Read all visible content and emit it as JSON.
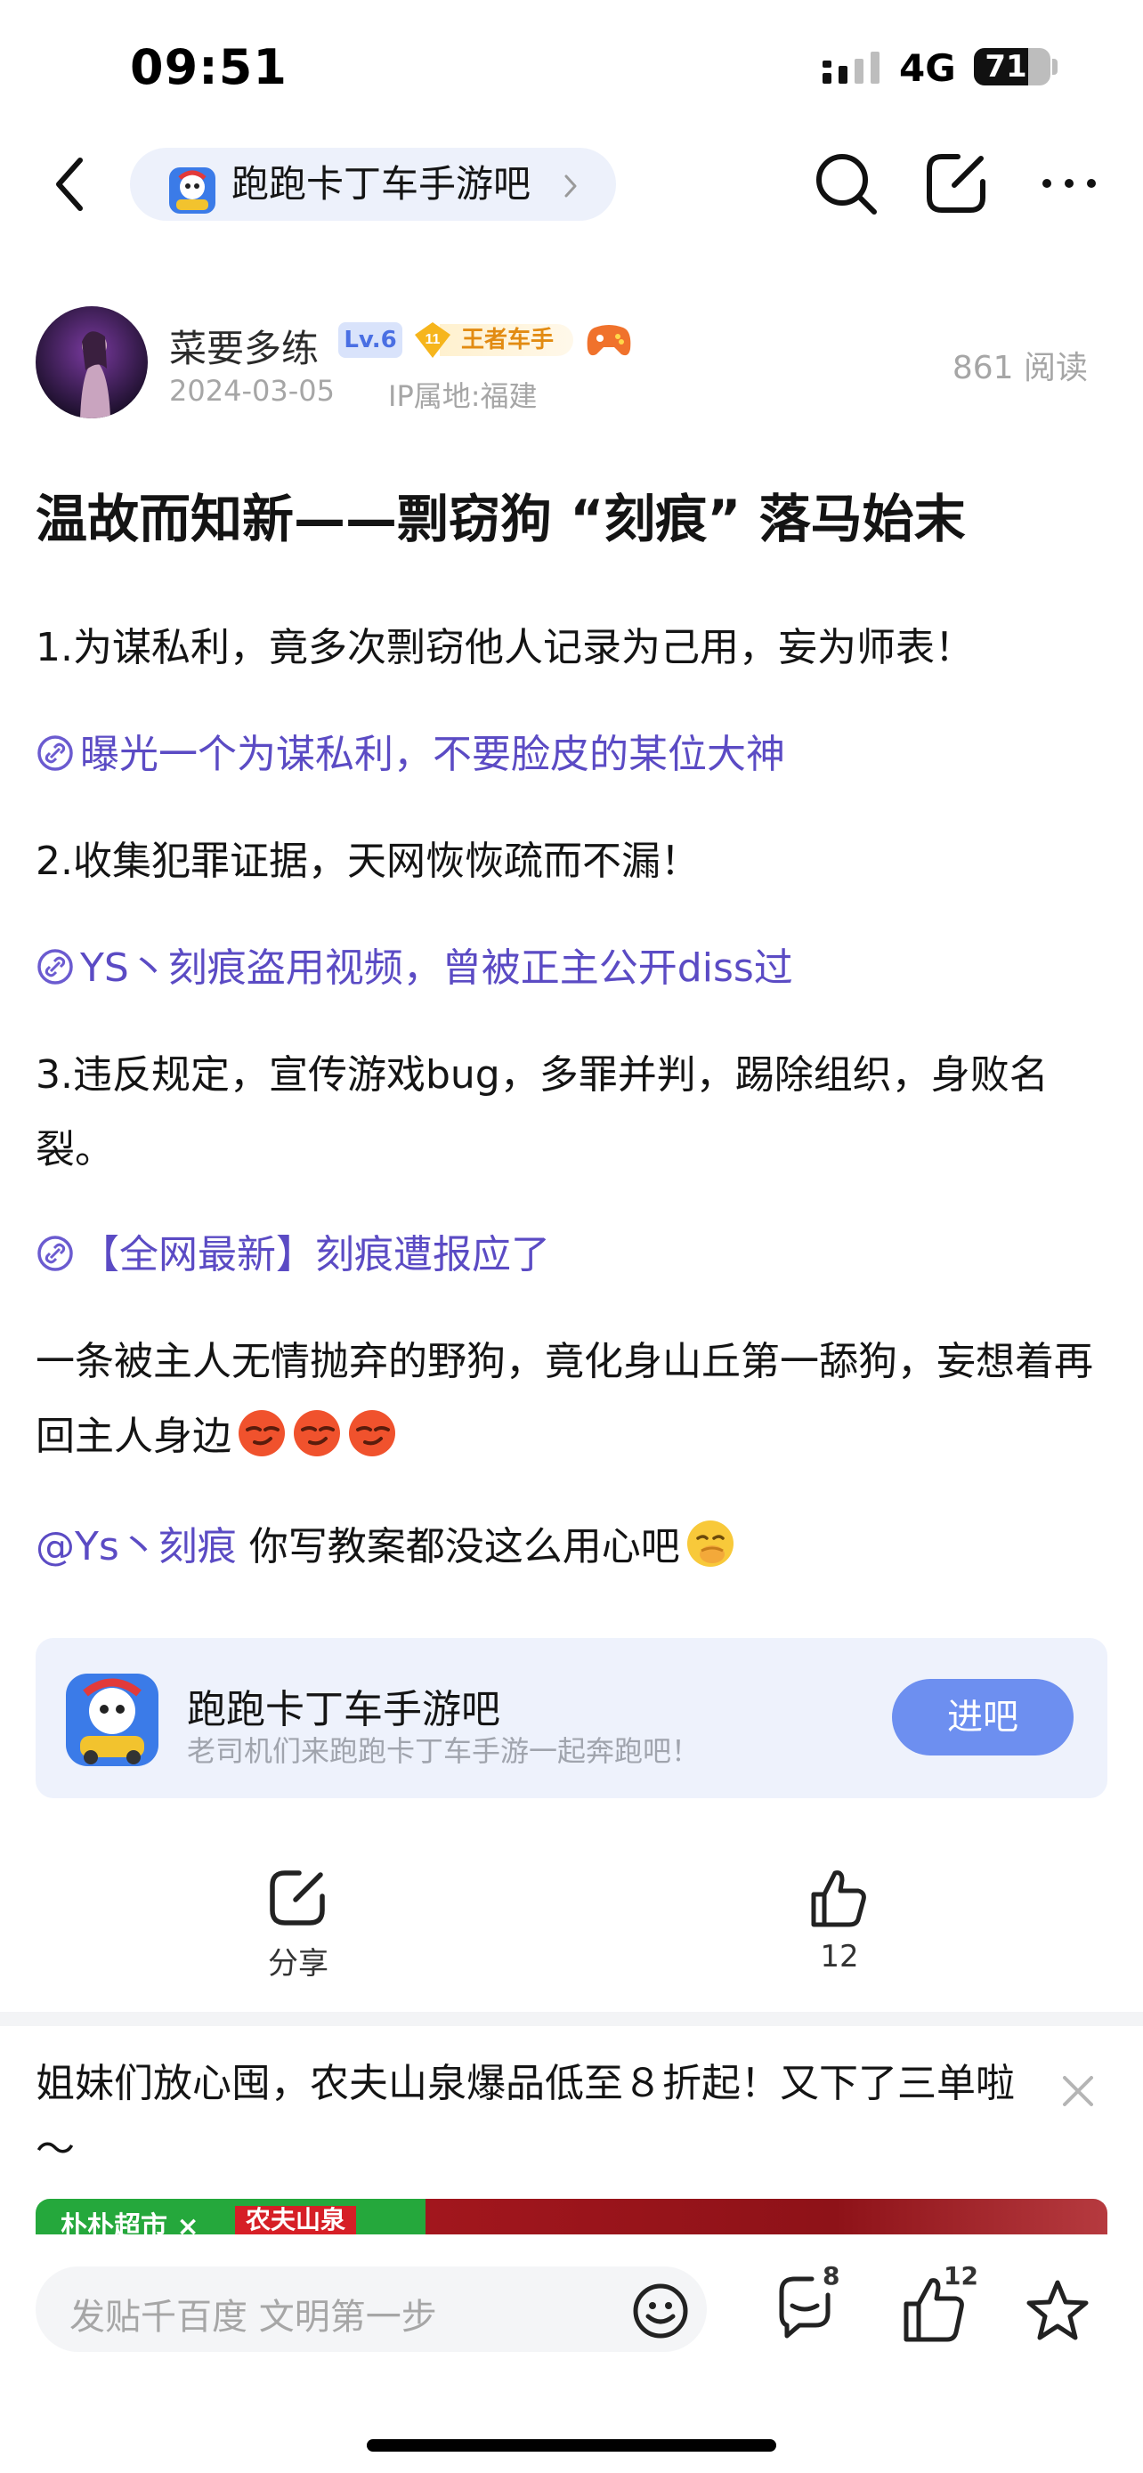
{
  "status_bar": {
    "time": "09:51",
    "network": "4G",
    "battery": "71",
    "battery_level": 0.71
  },
  "nav": {
    "forum_name": "跑跑卡丁车手游吧"
  },
  "author": {
    "name": "菜要多练",
    "level": "Lv.6",
    "rank_level": "11",
    "rank_title": "王者车手",
    "date": "2024-03-05",
    "ip": "IP属地:福建",
    "reads": "861 阅读"
  },
  "post": {
    "title": "温故而知新——剽窃狗 “刻痕” 落马始末",
    "p1": "1.为谋私利，竟多次剽窃他人记录为己用，妄为师表！",
    "link1": "曝光一个为谋私利，不要脸皮的某位大神",
    "p2": "2.收集犯罪证据，天网恢恢疏而不漏！",
    "link2": "YS丶刻痕盗用视频，曾被正主公开diss过",
    "p3": "3.违反规定，宣传游戏bug，多罪并判，踢除组织，身败名裂。",
    "link3": "【全网最新】刻痕遭报应了",
    "p4": "一条被主人无情抛弃的野狗，竟化身山丘第一舔狗，妄想着再回主人身边",
    "mention": "@Ys丶刻痕",
    "p5_text": " 你写教案都没这么用心吧"
  },
  "forum_card": {
    "name": "跑跑卡丁车手游吧",
    "desc": "老司机们来跑跑卡丁车手游一起奔跑吧！",
    "enter_label": "进吧"
  },
  "actions": {
    "share_label": "分享",
    "like_count": "12"
  },
  "ad": {
    "text": "姐妹们放心囤，农夫山泉爆品低至８折起！又下了三单啦～",
    "brand_label": "朴朴超市",
    "brand_sep": "×",
    "tag_label": "农夫山泉"
  },
  "bottom_bar": {
    "comment_placeholder": "发贴千百度 文明第一步",
    "comment_count": "8",
    "like_count": "12"
  },
  "colors": {
    "link": "#5b4bc4",
    "accent_blue": "#6d8ff0",
    "card_bg": "#eef2fc"
  }
}
